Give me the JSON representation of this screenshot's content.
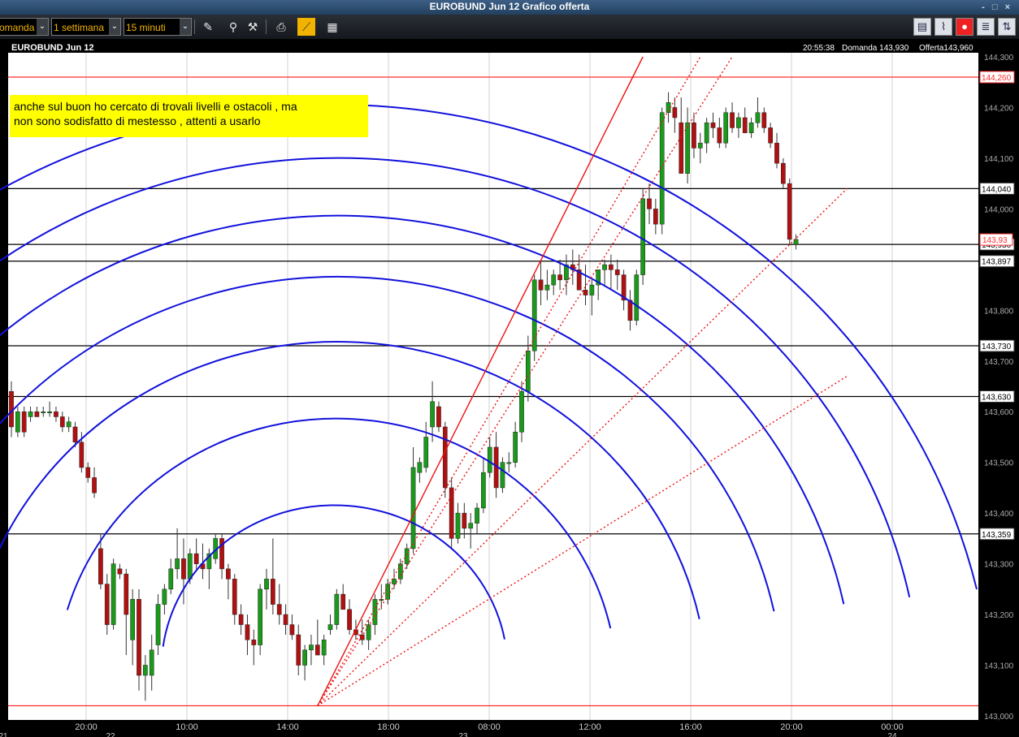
{
  "window": {
    "title": "EUROBUND Jun 12 Grafico offerta",
    "controls": "- □ ×"
  },
  "toolbar": {
    "price_type": "omanda",
    "range": "1 settimana",
    "interval": "15 minuti",
    "dropdown_arrow": "⌄",
    "tools": [
      "pencil-icon",
      "pin-icon",
      "magnet-icon",
      "print-icon",
      "trend-tool-icon",
      "grid-icon"
    ],
    "right_buttons": [
      "layout-icon",
      "indicator-icon",
      "alert-icon",
      "notes-icon",
      "trade-icon"
    ]
  },
  "chart_header": {
    "instrument": "EUROBUND Jun 12",
    "time": "20:55:38",
    "bid": "Domanda 143,930",
    "ask": "Offerta143,960"
  },
  "annotation": {
    "line1": "anche sul buon ho cercato di trovali livelli e ostacoli , ma",
    "line2": "non sono sodisfatto di mestesso , attenti a usarlo"
  },
  "chart_data": {
    "type": "candlestick",
    "title": "EUROBUND Jun 12",
    "ylim": [
      143.0,
      144.3
    ],
    "y_ticks": [
      "144,300",
      "144,200",
      "144,100",
      "144,000",
      "143,900",
      "143,800",
      "143,700",
      "143,600",
      "143,500",
      "143,400",
      "143,300",
      "143,200",
      "143,100",
      "143,000"
    ],
    "x_ticks": [
      "20:00",
      "10:00",
      "14:00",
      "18:00",
      "08:00",
      "12:00",
      "16:00",
      "20:00",
      "00:00"
    ],
    "date_labels": [
      "21",
      "22",
      "23",
      "24"
    ],
    "horizontal_levels": [
      {
        "value": 144.26,
        "label": "144,260",
        "color": "#ff2a2a"
      },
      {
        "value": 144.04,
        "label": "144,040",
        "color": "#000000"
      },
      {
        "value": 143.93,
        "label": "143,930",
        "color": "#000000"
      },
      {
        "value": 143.897,
        "label": "143,897",
        "color": "#000000"
      },
      {
        "value": 143.73,
        "label": "143,730",
        "color": "#000000"
      },
      {
        "value": 143.63,
        "label": "143,630",
        "color": "#000000"
      },
      {
        "value": 143.359,
        "label": "143,359",
        "color": "#000000"
      },
      {
        "value": 143.02,
        "label": "",
        "color": "#ff2a2a"
      }
    ],
    "last_price": {
      "value": 143.93,
      "label": "143,93",
      "color": "#ff2a2a"
    },
    "colors": {
      "up": "#1a9a1a",
      "down": "#b01010",
      "arc": "#1111dd",
      "fan": "#ee1111",
      "annotation_bg": "#ffff00"
    },
    "candles_ohlc": [
      [
        143.64,
        143.66,
        143.55,
        143.57
      ],
      [
        143.56,
        143.61,
        143.55,
        143.6
      ],
      [
        143.6,
        143.61,
        143.55,
        143.56
      ],
      [
        143.59,
        143.61,
        143.58,
        143.6
      ],
      [
        143.6,
        143.61,
        143.59,
        143.59
      ],
      [
        143.6,
        143.61,
        143.59,
        143.6
      ],
      [
        143.6,
        143.62,
        143.59,
        143.6
      ],
      [
        143.6,
        143.61,
        143.58,
        143.59
      ],
      [
        143.59,
        143.6,
        143.56,
        143.57
      ],
      [
        143.57,
        143.59,
        143.56,
        143.58
      ],
      [
        143.57,
        143.58,
        143.53,
        143.54
      ],
      [
        143.54,
        143.56,
        143.48,
        143.49
      ],
      [
        143.49,
        143.5,
        143.46,
        143.47
      ],
      [
        143.47,
        143.49,
        143.43,
        143.44
      ],
      [
        143.33,
        143.36,
        143.25,
        143.26
      ],
      [
        143.26,
        143.28,
        143.16,
        143.18
      ],
      [
        143.18,
        143.31,
        143.17,
        143.3
      ],
      [
        143.29,
        143.3,
        143.27,
        143.28
      ],
      [
        143.28,
        143.29,
        143.12,
        143.2
      ],
      [
        143.15,
        143.25,
        143.1,
        143.23
      ],
      [
        143.23,
        143.25,
        143.05,
        143.08
      ],
      [
        143.08,
        143.12,
        143.03,
        143.1
      ],
      [
        143.08,
        143.16,
        143.05,
        143.13
      ],
      [
        143.14,
        143.24,
        143.12,
        143.22
      ],
      [
        143.22,
        143.26,
        143.2,
        143.25
      ],
      [
        143.25,
        143.31,
        143.24,
        143.29
      ],
      [
        143.29,
        143.37,
        143.27,
        143.31
      ],
      [
        143.31,
        143.35,
        143.22,
        143.27
      ],
      [
        143.27,
        143.33,
        143.26,
        143.32
      ],
      [
        143.32,
        143.35,
        143.29,
        143.3
      ],
      [
        143.3,
        143.34,
        143.27,
        143.29
      ],
      [
        143.29,
        143.33,
        143.25,
        143.32
      ],
      [
        143.31,
        143.36,
        143.3,
        143.35
      ],
      [
        143.35,
        143.36,
        143.27,
        143.29
      ],
      [
        143.29,
        143.3,
        143.23,
        143.27
      ],
      [
        143.27,
        143.28,
        143.18,
        143.2
      ],
      [
        143.2,
        143.22,
        143.16,
        143.18
      ],
      [
        143.18,
        143.2,
        143.12,
        143.15
      ],
      [
        143.15,
        143.17,
        143.1,
        143.14
      ],
      [
        143.14,
        143.26,
        143.12,
        143.25
      ],
      [
        143.25,
        143.29,
        143.21,
        143.27
      ],
      [
        143.27,
        143.35,
        143.2,
        143.22
      ],
      [
        143.22,
        143.26,
        143.18,
        143.2
      ],
      [
        143.2,
        143.22,
        143.16,
        143.18
      ],
      [
        143.18,
        143.2,
        143.15,
        143.16
      ],
      [
        143.16,
        143.18,
        143.08,
        143.1
      ],
      [
        143.1,
        143.14,
        143.07,
        143.13
      ],
      [
        143.13,
        143.16,
        143.1,
        143.14
      ],
      [
        143.14,
        143.19,
        143.12,
        143.12
      ],
      [
        143.12,
        143.16,
        143.1,
        143.15
      ],
      [
        143.17,
        143.2,
        143.16,
        143.18
      ],
      [
        143.18,
        143.25,
        143.17,
        143.24
      ],
      [
        143.24,
        143.26,
        143.21,
        143.21
      ],
      [
        143.21,
        143.23,
        143.16,
        143.17
      ],
      [
        143.17,
        143.19,
        143.15,
        143.16
      ],
      [
        143.16,
        143.19,
        143.14,
        143.15
      ],
      [
        143.15,
        143.19,
        143.13,
        143.18
      ],
      [
        143.18,
        143.24,
        143.16,
        143.23
      ],
      [
        143.23,
        143.26,
        143.21,
        143.23
      ],
      [
        143.23,
        143.27,
        143.22,
        143.26
      ],
      [
        143.26,
        143.29,
        143.25,
        143.27
      ],
      [
        143.27,
        143.31,
        143.26,
        143.3
      ],
      [
        143.3,
        143.34,
        143.29,
        143.33
      ],
      [
        143.33,
        143.53,
        143.32,
        143.49
      ],
      [
        143.48,
        143.51,
        143.46,
        143.5
      ],
      [
        143.49,
        143.58,
        143.48,
        143.55
      ],
      [
        143.57,
        143.66,
        143.54,
        143.62
      ],
      [
        143.61,
        143.62,
        143.56,
        143.57
      ],
      [
        143.57,
        143.58,
        143.43,
        143.45
      ],
      [
        143.45,
        143.47,
        143.33,
        143.35
      ],
      [
        143.35,
        143.42,
        143.34,
        143.4
      ],
      [
        143.4,
        143.42,
        143.35,
        143.37
      ],
      [
        143.37,
        143.4,
        143.33,
        143.38
      ],
      [
        143.38,
        143.42,
        143.36,
        143.41
      ],
      [
        143.41,
        143.51,
        143.4,
        143.48
      ],
      [
        143.48,
        143.55,
        143.47,
        143.53
      ],
      [
        143.53,
        143.56,
        143.43,
        143.45
      ],
      [
        143.45,
        143.51,
        143.44,
        143.5
      ],
      [
        143.5,
        143.52,
        143.48,
        143.5
      ],
      [
        143.5,
        143.58,
        143.49,
        143.56
      ],
      [
        143.56,
        143.66,
        143.54,
        143.64
      ],
      [
        143.64,
        143.75,
        143.62,
        143.72
      ],
      [
        143.72,
        143.87,
        143.7,
        143.86
      ],
      [
        143.86,
        143.9,
        143.81,
        143.84
      ],
      [
        143.84,
        143.88,
        143.82,
        143.85
      ],
      [
        143.85,
        143.88,
        143.83,
        143.87
      ],
      [
        143.87,
        143.9,
        143.84,
        143.86
      ],
      [
        143.86,
        143.91,
        143.83,
        143.89
      ],
      [
        143.89,
        143.92,
        143.85,
        143.88
      ],
      [
        143.88,
        143.91,
        143.85,
        143.84
      ],
      [
        143.84,
        143.89,
        143.81,
        143.83
      ],
      [
        143.83,
        143.86,
        143.79,
        143.85
      ],
      [
        143.85,
        143.87,
        143.82,
        143.88
      ],
      [
        143.88,
        143.9,
        143.85,
        143.89
      ],
      [
        143.89,
        143.91,
        143.84,
        143.88
      ],
      [
        143.88,
        143.9,
        143.84,
        143.87
      ],
      [
        143.87,
        143.88,
        143.8,
        143.82
      ],
      [
        143.82,
        143.84,
        143.76,
        143.78
      ],
      [
        143.78,
        143.88,
        143.77,
        143.87
      ],
      [
        143.87,
        144.04,
        143.85,
        144.02
      ],
      [
        144.02,
        144.05,
        143.97,
        144.0
      ],
      [
        144.0,
        144.02,
        143.95,
        143.97
      ],
      [
        143.97,
        144.2,
        143.95,
        144.19
      ],
      [
        144.19,
        144.23,
        144.17,
        144.21
      ],
      [
        144.2,
        144.22,
        144.15,
        144.18
      ],
      [
        144.17,
        144.22,
        144.08,
        144.07
      ],
      [
        144.07,
        144.2,
        144.05,
        144.17
      ],
      [
        144.17,
        144.19,
        144.1,
        144.12
      ],
      [
        144.12,
        144.15,
        144.09,
        144.13
      ],
      [
        144.13,
        144.18,
        144.11,
        144.17
      ],
      [
        144.17,
        144.19,
        144.14,
        144.16
      ],
      [
        144.16,
        144.18,
        144.12,
        144.13
      ],
      [
        144.13,
        144.2,
        144.12,
        144.19
      ],
      [
        144.19,
        144.21,
        144.15,
        144.16
      ],
      [
        144.16,
        144.19,
        144.14,
        144.18
      ],
      [
        144.18,
        144.2,
        144.16,
        144.15
      ],
      [
        144.15,
        144.18,
        144.14,
        144.17
      ],
      [
        144.17,
        144.22,
        144.16,
        144.19
      ],
      [
        144.19,
        144.2,
        144.15,
        144.16
      ],
      [
        144.16,
        144.17,
        144.12,
        144.13
      ],
      [
        144.13,
        144.15,
        144.08,
        144.09
      ],
      [
        144.09,
        144.1,
        144.04,
        144.05
      ],
      [
        144.05,
        144.06,
        143.93,
        143.94
      ],
      [
        143.93,
        143.95,
        143.92,
        143.94
      ]
    ],
    "gann_fan_origin": {
      "time_index": 48,
      "price": 143.02
    },
    "fan_lines": [
      {
        "style": "solid",
        "to_time_index": 99,
        "to_price": 144.3
      },
      {
        "style": "dotted",
        "to_time_index": 108,
        "to_price": 144.3
      },
      {
        "style": "dotted",
        "to_time_index": 113,
        "to_price": 144.3
      },
      {
        "style": "dotted",
        "to_time_index": 131,
        "to_price": 144.04
      },
      {
        "style": "dotted",
        "to_time_index": 131,
        "to_price": 143.67
      }
    ],
    "arcs_count": 7
  }
}
